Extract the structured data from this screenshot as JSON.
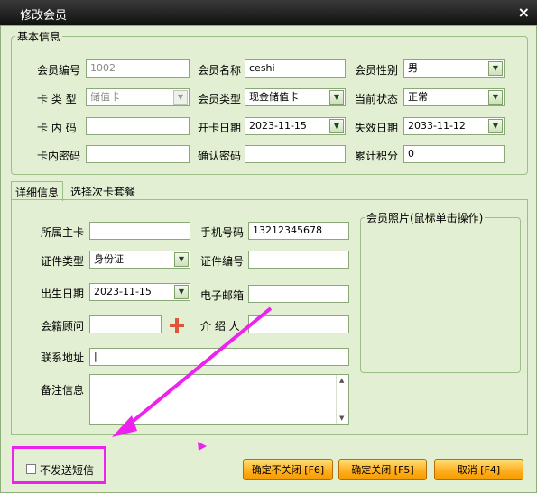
{
  "window": {
    "title": "修改会员",
    "close_glyph": "×"
  },
  "basic": {
    "legend": "基本信息",
    "member_no": {
      "label": "会员编号",
      "value": "1002"
    },
    "member_name": {
      "label": "会员名称",
      "value": "ceshi"
    },
    "gender": {
      "label": "会员性别",
      "value": "男"
    },
    "card_type": {
      "label": "卡 类 型",
      "value": "储值卡"
    },
    "member_type": {
      "label": "会员类型",
      "value": "现金储值卡"
    },
    "status": {
      "label": "当前状态",
      "value": "正常"
    },
    "card_code": {
      "label": "卡 内 码",
      "value": ""
    },
    "open_date": {
      "label": "开卡日期",
      "value": "2023-11-15"
    },
    "expire_date": {
      "label": "失效日期",
      "value": "2033-11-12"
    },
    "card_password": {
      "label": "卡内密码",
      "value": ""
    },
    "confirm_password": {
      "label": "确认密码",
      "value": ""
    },
    "points": {
      "label": "累计积分",
      "value": "0"
    }
  },
  "tabs": [
    {
      "label": "详细信息"
    },
    {
      "label": "选择次卡套餐"
    }
  ],
  "detail": {
    "main_card": {
      "label": "所属主卡",
      "value": ""
    },
    "phone": {
      "label": "手机号码",
      "value": "13212345678"
    },
    "id_type": {
      "label": "证件类型",
      "value": "身份证"
    },
    "id_no": {
      "label": "证件编号",
      "value": ""
    },
    "birth_date": {
      "label": "出生日期",
      "value": "2023-11-15"
    },
    "email": {
      "label": "电子邮箱",
      "value": ""
    },
    "advisor": {
      "label": "会籍顾问",
      "value": ""
    },
    "referrer": {
      "label": "介 绍 人",
      "value": ""
    },
    "address": {
      "label": "联系地址",
      "value": "|"
    },
    "remark": {
      "label": "备注信息",
      "value": ""
    },
    "photo_legend": "会员照片(鼠标单击操作)"
  },
  "footer": {
    "no_sms_label": "不发送短信",
    "btn_no_close": "确定不关闭 [F6]",
    "btn_close": "确定关闭 [F5]",
    "btn_cancel": "取消 [F4]"
  },
  "colors": {
    "annotation": "#ee22ee",
    "button": "#ffb020",
    "background": "#e3efd3"
  },
  "icons": {
    "select_arrow": "▼",
    "scroll_up": "▲",
    "scroll_down": "▼",
    "plus": "plus-icon"
  }
}
